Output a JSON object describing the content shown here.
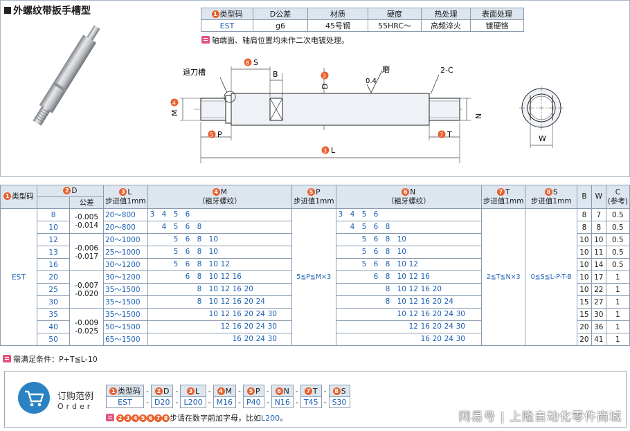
{
  "title": "外螺纹带扳手槽型",
  "spec_table": {
    "headers": [
      "类型码",
      "D公差",
      "材质",
      "硬度",
      "热处理",
      "表面处理"
    ],
    "header_num": "1",
    "values": [
      "EST",
      "g6",
      "45号钢",
      "55HRC～",
      "高频淬火",
      "镀硬铬"
    ]
  },
  "note_top": "轴端面、轴肩位置均未作二次电镀处理。",
  "drawing": {
    "label_undercut": "退刀槽",
    "label_s": "S",
    "num_s": "8",
    "label_b": "B",
    "label_d": "D",
    "num_d": "2",
    "label_grind": "磨",
    "label_roughness": "0.4",
    "label_chamfer": "2-C",
    "label_m": "M",
    "num_m": "4",
    "label_n": "N",
    "num_n": "6",
    "label_p": "P",
    "num_p": "5",
    "label_t": "T",
    "num_t": "7",
    "label_l": "L",
    "num_l": "3",
    "label_w": "W"
  },
  "main_table": {
    "h_type": "类型码",
    "h_type_num": "1",
    "h_d": "D",
    "h_d_num": "2",
    "h_tol": "公差",
    "h_l": "L",
    "h_l_num": "3",
    "h_l_step": "步进值1mm",
    "h_m": "M",
    "h_m_num": "4",
    "h_m_sub": "（粗牙螺纹）",
    "h_p": "P",
    "h_p_num": "5",
    "h_p_step": "步进值1mm",
    "h_n": "N",
    "h_n_num": "6",
    "h_n_sub": "（粗牙螺纹）",
    "h_t": "T",
    "h_t_num": "7",
    "h_t_step": "步进值1mm",
    "h_s": "S",
    "h_s_num": "8",
    "h_s_step": "步进值1mm",
    "h_b": "B",
    "h_w": "W",
    "h_c": "C",
    "h_c_sub": "(参考)",
    "type_code": "EST",
    "p_range": "5≦P≦M×3",
    "t_range": "2≦T≦N×3",
    "s_range": "0≦S≦L-P-T-B",
    "rows": [
      {
        "d": "8",
        "l": "20～800",
        "m": "3 4 5 6",
        "n": "3 4 5 6",
        "b": "8",
        "w": "7",
        "c": "0.5"
      },
      {
        "d": "10",
        "l": "20～800",
        "m": "4 5 6 8",
        "n": "4 5 6 8",
        "b": "8",
        "w": "8",
        "c": "0.5"
      },
      {
        "d": "12",
        "l": "20～1000",
        "m": "5 6 8 10",
        "n": "5 6 8 10",
        "b": "10",
        "w": "10",
        "c": "0.5"
      },
      {
        "d": "13",
        "l": "25～1000",
        "m": "5 6 8 10",
        "n": "5 6 8 10",
        "b": "10",
        "w": "11",
        "c": "0.5"
      },
      {
        "d": "16",
        "l": "30～1200",
        "m": "5 6 8 10 12",
        "n": "5 6 8 10 12",
        "b": "10",
        "w": "14",
        "c": "0.5"
      },
      {
        "d": "20",
        "l": "30～1200",
        "m": "6 8 10 12 16",
        "n": "6 8 10 12 16",
        "b": "10",
        "w": "17",
        "c": "1"
      },
      {
        "d": "25",
        "l": "35～1500",
        "m": "8 10 12 16 20",
        "n": "8 10 12 16 20",
        "b": "10",
        "w": "22",
        "c": "1"
      },
      {
        "d": "30",
        "l": "35～1500",
        "m": "8 10 12 16 20 24",
        "n": "8 10 12 16 20 24",
        "b": "15",
        "w": "27",
        "c": "1"
      },
      {
        "d": "35",
        "l": "35～1500",
        "m": "10 12 16 20 24 30",
        "n": "10 12 16 20 24 30",
        "b": "15",
        "w": "30",
        "c": "1"
      },
      {
        "d": "40",
        "l": "50～1500",
        "m": "12 16 20 24 30",
        "n": "12 16 20 24 30",
        "b": "20",
        "w": "36",
        "c": "1"
      },
      {
        "d": "50",
        "l": "65～1500",
        "m": "16 20 24 30",
        "n": "16 20 24 30",
        "b": "20",
        "w": "41",
        "c": "1"
      }
    ],
    "tol_groups": [
      {
        "upper": "-0.005",
        "lower": "-0.014"
      },
      {
        "upper": "-0.006",
        "lower": "-0.017"
      },
      {
        "upper": "-0.007",
        "lower": "-0.020"
      },
      {
        "upper": "-0.009",
        "lower": "-0.025"
      }
    ]
  },
  "note_mid": "需满足条件：P+T≦L-10",
  "order": {
    "title": "订购范例",
    "subtitle": "Order",
    "headers": [
      {
        "num": "1",
        "label": "类型码"
      },
      {
        "num": "2",
        "label": "D"
      },
      {
        "num": "3",
        "label": "L"
      },
      {
        "num": "4",
        "label": "M"
      },
      {
        "num": "5",
        "label": "P"
      },
      {
        "num": "6",
        "label": "N"
      },
      {
        "num": "7",
        "label": "T"
      },
      {
        "num": "8",
        "label": "S"
      }
    ],
    "values": [
      "EST",
      "D20",
      "L200",
      "M16",
      "P40",
      "N16",
      "T45",
      "S30"
    ],
    "note_nums": [
      "2",
      "3",
      "4",
      "5",
      "6",
      "7",
      "8"
    ],
    "note_text": "步请在数字前加字母，比如",
    "note_example": "L200",
    "note_end": "。"
  },
  "watermark": "网易号 | 上隆自动化零件商城",
  "colors": {
    "accent": "#e8602c",
    "header_bg": "#dde6ef",
    "value_blue": "#1a5fb4",
    "note_pink": "#e0567d",
    "order_icon": "#2a82c4"
  }
}
